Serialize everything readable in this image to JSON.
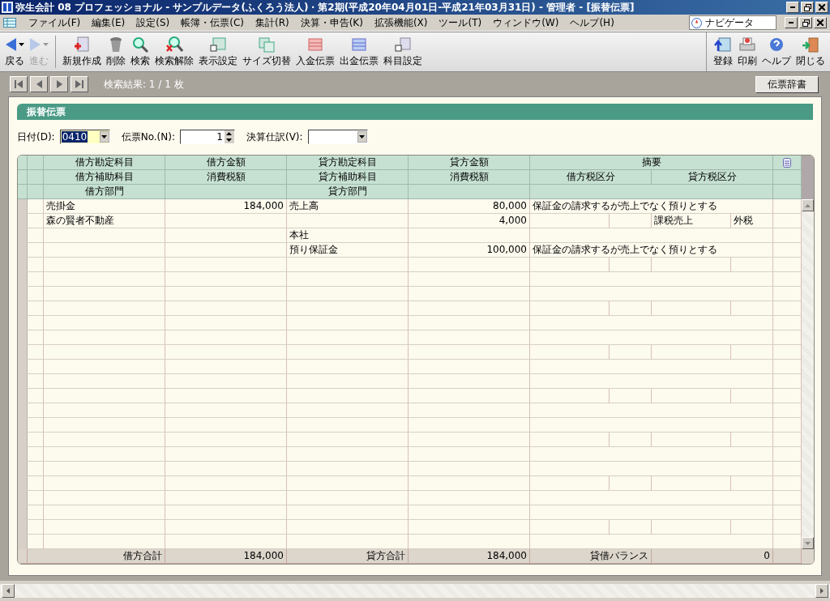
{
  "window": {
    "title": "弥生会計 08 プロフェッショナル - サンプルデータ(ふくろう法人)・第2期(平成20年04月01日-平成21年03月31日) - 管理者 - [振替伝票]"
  },
  "menu": [
    "ファイル(F)",
    "編集(E)",
    "設定(S)",
    "帳簿・伝票(C)",
    "集計(R)",
    "決算・申告(K)",
    "拡張機能(X)",
    "ツール(T)",
    "ウィンドウ(W)",
    "ヘルプ(H)"
  ],
  "navigator": {
    "label": "ナビゲータ"
  },
  "toolbar": {
    "left": [
      {
        "label": "戻る",
        "disabled": false,
        "dropdown": true
      },
      {
        "label": "進む",
        "disabled": true,
        "dropdown": true
      },
      {
        "label": "新規作成",
        "disabled": false,
        "dropdown": false
      },
      {
        "label": "削除",
        "disabled": false,
        "dropdown": false
      },
      {
        "label": "検索",
        "disabled": false,
        "dropdown": false
      },
      {
        "label": "検索解除",
        "disabled": false,
        "dropdown": false
      },
      {
        "label": "表示設定",
        "disabled": false,
        "dropdown": false
      },
      {
        "label": "サイズ切替",
        "disabled": false,
        "dropdown": false
      },
      {
        "label": "入金伝票",
        "disabled": false,
        "dropdown": false
      },
      {
        "label": "出金伝票",
        "disabled": false,
        "dropdown": false
      },
      {
        "label": "科目設定",
        "disabled": false,
        "dropdown": false
      }
    ],
    "right": [
      {
        "label": "登録",
        "disabled": false
      },
      {
        "label": "印刷",
        "disabled": false
      },
      {
        "label": "ヘルプ",
        "disabled": false
      },
      {
        "label": "閉じる",
        "disabled": false
      }
    ]
  },
  "results": "検索結果: 1 / 1 枚",
  "dictionary_button": "伝票辞書",
  "section_title": "振替伝票",
  "form": {
    "date": {
      "label": "日付(D):",
      "value": "0410"
    },
    "number": {
      "label": "伝票No.(N):",
      "value": "1"
    },
    "closing": {
      "label": "決算仕訳(V):"
    }
  },
  "grid": {
    "header_1": {
      "debit_account": "借方勘定科目",
      "debit_amount": "借方金額",
      "credit_account": "貸方勘定科目",
      "credit_amount": "貸方金額",
      "memo": "摘要"
    },
    "header_2": {
      "debit_sub": "借方補助科目",
      "debit_tax": "消費税額",
      "credit_sub": "貸方補助科目",
      "credit_tax": "消費税額",
      "debit_tax_class": "借方税区分",
      "credit_tax_class": "貸方税区分"
    },
    "header_3": {
      "debit_dept": "借方部門",
      "credit_dept": "貸方部門"
    },
    "entries": [
      {
        "debit_account": "売掛金",
        "debit_amount": "184,000",
        "credit_account": "売上高",
        "credit_amount": "80,000",
        "memo": "保証金の請求するが売上でなく預りとする",
        "debit_sub": "森の賢者不動産",
        "credit_tax": "4,000",
        "credit_tax_class": "課税売上",
        "credit_tax_method": "外税",
        "credit_dept": "本社"
      },
      {
        "credit_account": "預り保証金",
        "credit_amount": "100,000",
        "memo": "保証金の請求するが売上でなく預りとする"
      }
    ],
    "totals": {
      "debit_label": "借方合計",
      "debit_total": "184,000",
      "credit_label": "貸方合計",
      "credit_total": "184,000",
      "balance_label": "貸借バランス",
      "balance": "0"
    }
  }
}
